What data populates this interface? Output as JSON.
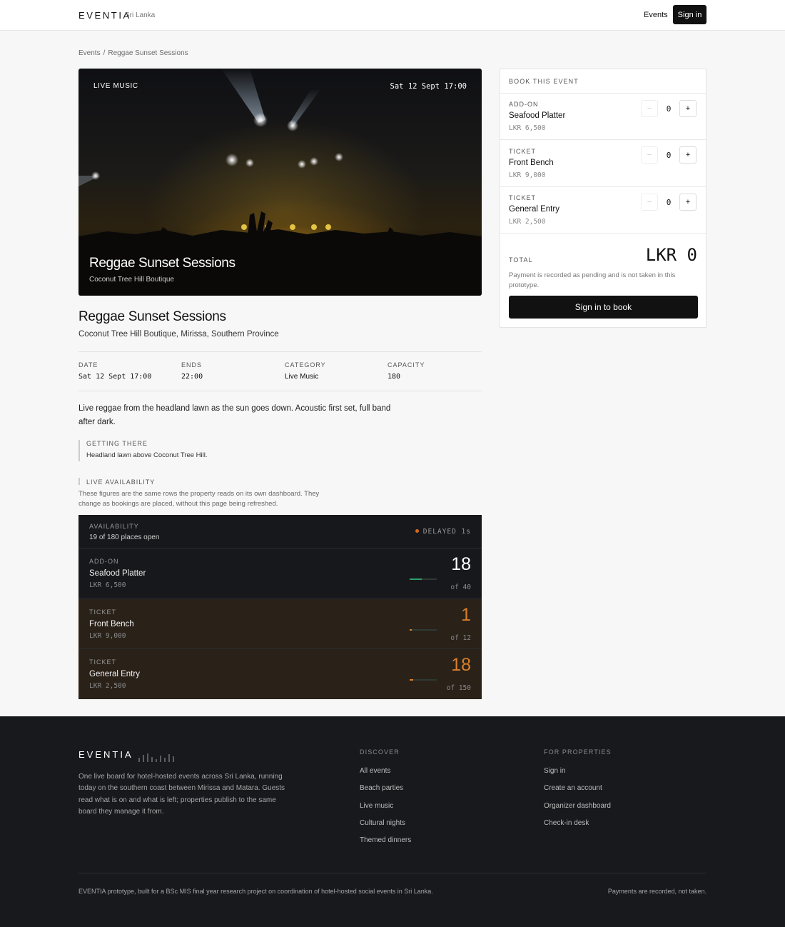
{
  "header": {
    "brand": "EVENTIA",
    "region": "Sri Lanka",
    "nav_events": "Events",
    "sign_in": "Sign in"
  },
  "breadcrumb": {
    "items": [
      "Events",
      "/",
      "Reggae Sunset Sessions"
    ]
  },
  "hero": {
    "tag": "LIVE MUSIC",
    "datetime": "Sat 12 Sept 17:00",
    "title": "Reggae Sunset Sessions",
    "venue": "Coconut Tree Hill Boutique"
  },
  "event": {
    "title": "Reggae Sunset Sessions",
    "location": "Coconut Tree Hill Boutique, Mirissa, Southern Province",
    "meta": [
      {
        "label": "DATE",
        "value": "Sat 12 Sept 17:00"
      },
      {
        "label": "ENDS",
        "value": "22:00"
      },
      {
        "label": "CATEGORY",
        "value": "Live Music"
      },
      {
        "label": "CAPACITY",
        "value": "180"
      }
    ],
    "description": "Live reggae from the headland lawn as the sun goes down. Acoustic first set, full band after dark.",
    "getting_there_label": "GETTING THERE",
    "getting_there_text": "Headland lawn above Coconut Tree Hill.",
    "live_label": "LIVE AVAILABILITY",
    "live_note": "These figures are the same rows the property reads on its own dashboard. They change as bookings are placed, without this page being refreshed."
  },
  "availability": {
    "label": "AVAILABILITY",
    "summary": "19 of 180 places open",
    "status": "DELAYED 1s",
    "status_color": "#d86a1e",
    "rows": [
      {
        "kind": "ADD-ON",
        "name": "Seafood Platter",
        "price": "LKR 6,500",
        "remaining": "18",
        "of": "of 40",
        "fraction": 0.45
      },
      {
        "kind": "TICKET",
        "name": "Front Bench",
        "price": "LKR 9,000",
        "remaining": "1",
        "of": "of 12",
        "fraction": 0.083
      },
      {
        "kind": "TICKET",
        "name": "General Entry",
        "price": "LKR 2,500",
        "remaining": "18",
        "of": "of 150",
        "fraction": 0.12
      }
    ]
  },
  "booking": {
    "title": "BOOK THIS EVENT",
    "items": [
      {
        "kind": "ADD-ON",
        "name": "Seafood Platter",
        "price": "LKR 6,500",
        "qty": "0"
      },
      {
        "kind": "TICKET",
        "name": "Front Bench",
        "price": "LKR 9,000",
        "qty": "0"
      },
      {
        "kind": "TICKET",
        "name": "General Entry",
        "price": "LKR 2,500",
        "qty": "0"
      }
    ],
    "minus": "−",
    "plus": "+",
    "total_label": "TOTAL",
    "total_value": "LKR 0",
    "payment_note": "Payment is recorded as pending and is not taken in this prototype.",
    "cta": "Sign in to book"
  },
  "footer": {
    "brand": "EVENTIA",
    "description": "One live board for hotel-hosted events across Sri Lanka, running today on the southern coast between Mirissa and Matara. Guests read what is on and what is left; properties publish to the same board they manage it from.",
    "discover_title": "DISCOVER",
    "discover_links": [
      "All events",
      "Beach parties",
      "Live music",
      "Cultural nights",
      "Themed dinners"
    ],
    "properties_title": "FOR PROPERTIES",
    "properties_links": [
      "Sign in",
      "Create an account",
      "Organizer dashboard",
      "Check-in desk"
    ],
    "bottom_left": "EVENTIA prototype, built for a BSc MIS final year research project on coordination of hotel-hosted social events in Sri Lanka.",
    "bottom_right": "Payments are recorded, not taken."
  }
}
